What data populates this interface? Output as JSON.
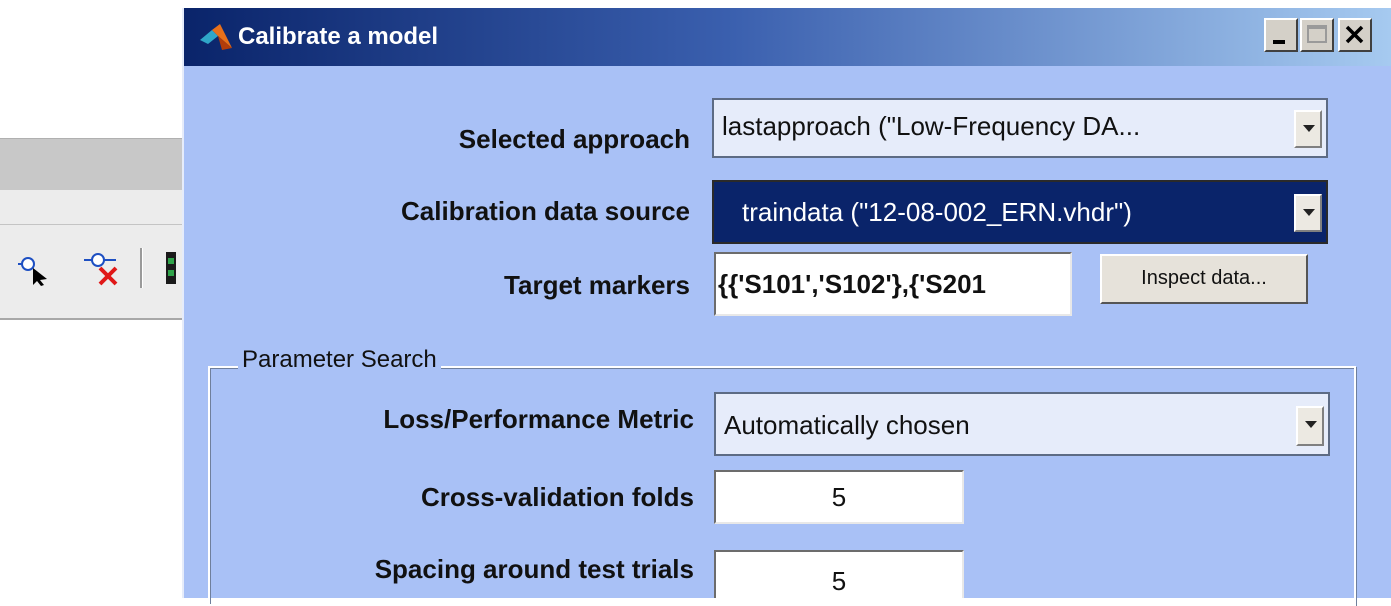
{
  "dialog": {
    "title": "Calibrate a model",
    "window_buttons": {
      "minimize": "_",
      "maximize": "□",
      "close": "✕"
    },
    "selected_approach": {
      "label": "Selected approach",
      "value": "lastapproach (\"Low-Frequency DA..."
    },
    "calibration_source": {
      "label": "Calibration data source",
      "value": "traindata (\"12-08-002_ERN.vhdr\")"
    },
    "target_markers": {
      "label": "Target markers",
      "value": "{{'S101','S102'},{'S201"
    },
    "inspect_button": "Inspect data...",
    "parameter_search": {
      "title": "Parameter Search",
      "metric": {
        "label": "Loss/Performance Metric",
        "value": "Automatically chosen"
      },
      "folds": {
        "label": "Cross-validation folds",
        "value": "5"
      },
      "spacing": {
        "label": "Spacing around test trials",
        "value": "5"
      }
    }
  },
  "colors": {
    "dialog_background": "#a9c1f6",
    "title_gradient_start": "#0a246a",
    "title_gradient_end": "#a6caf0",
    "selection": "#0a246a"
  },
  "icons": [
    "matlab-logo-icon",
    "zoom-arrow-icon",
    "remove-marker-icon",
    "toolbar-grip-icon"
  ]
}
